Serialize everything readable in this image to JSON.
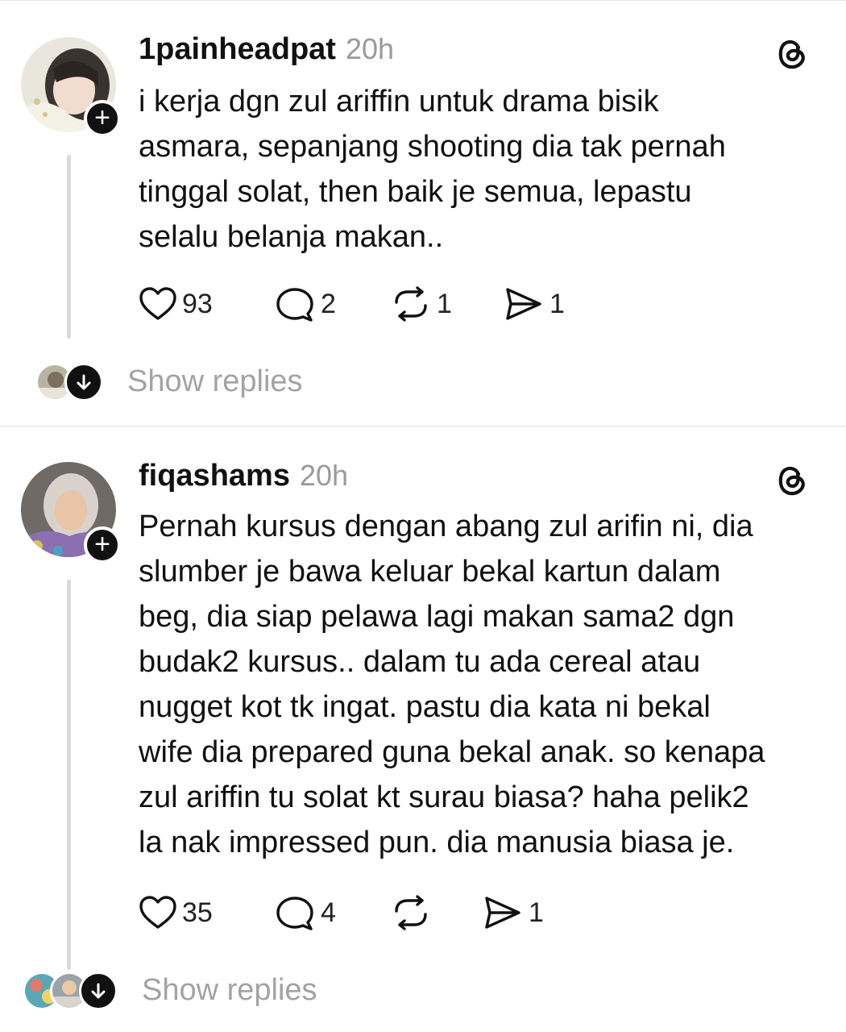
{
  "posts": [
    {
      "username": "1painheadpat",
      "time": "20h",
      "text": "i kerja dgn zul ariffin untuk drama bisik\nasmara, sepanjang shooting dia tak pernah\ntinggal solat, then baik je semua, lepastu\nselalu belanja makan..",
      "likes": "93",
      "comments": "2",
      "reposts": "1",
      "shares": "1",
      "show_replies": "Show replies"
    },
    {
      "username": "fiqashams",
      "time": "20h",
      "text": "Pernah kursus dengan abang zul arifin ni, dia\nslumber je bawa keluar bekal kartun dalam\nbeg, dia siap pelawa lagi makan sama2 dgn\nbudak2 kursus.. dalam tu ada cereal atau\nnugget kot tk ingat. pastu dia kata ni bekal\nwife dia prepared guna bekal anak. so kenapa\nzul ariffin tu solat kt surau biasa? haha pelik2\nla nak impressed pun. dia manusia biasa je.",
      "likes": "35",
      "comments": "4",
      "reposts": "",
      "shares": "1",
      "show_replies": "Show replies"
    }
  ],
  "icons": {
    "like": "heart-icon",
    "comment": "comment-icon",
    "repost": "repost-icon",
    "share": "send-icon",
    "brand": "threads-logo-icon",
    "follow": "plus-icon",
    "expand": "arrow-down-icon"
  }
}
